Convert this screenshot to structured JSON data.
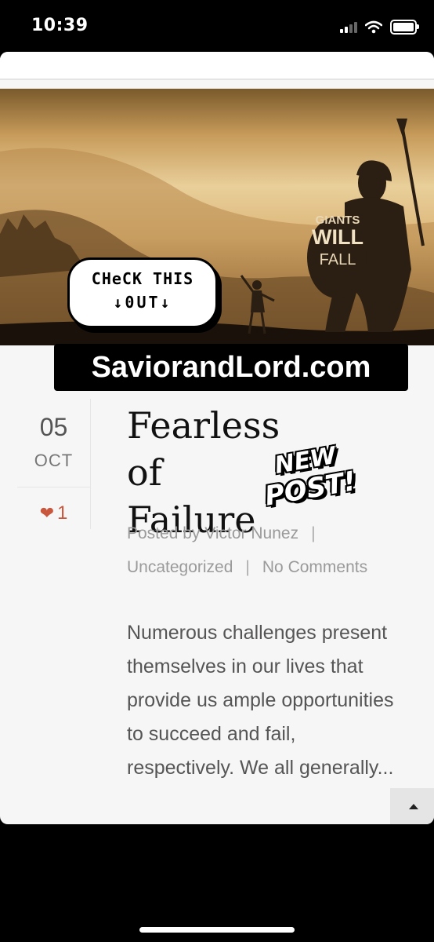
{
  "status_bar": {
    "time": "10:39",
    "signal_icon": "signal-icon",
    "wifi_icon": "wifi-icon",
    "battery_icon": "battery-icon"
  },
  "hero": {
    "image_icon": "giants-will-fall-image",
    "image_text": {
      "line1": "GIANTS",
      "line2": "WILL",
      "line3": "FALL"
    },
    "sticker": {
      "line1": "CHeCK THIS",
      "line2": "↓0UT↓"
    },
    "banner": "SaviorandLord.com"
  },
  "post": {
    "day": "05",
    "month": "OCT",
    "likes": "1",
    "heart_color": "#c8573d",
    "title_line1": "Fearless of",
    "title_line2": "Failure",
    "new_post_badge": {
      "line1": "NEW",
      "line2": "POST!"
    },
    "author": "Posted by Victor Nunez",
    "separator": "|",
    "category": "Uncategorized",
    "comments": "No Comments",
    "excerpt": "Numerous challenges present themselves in our lives that provide us ample opportunities to succeed and fail, respectively. We all generally..."
  },
  "back_to_top_icon": "caret-up-icon"
}
